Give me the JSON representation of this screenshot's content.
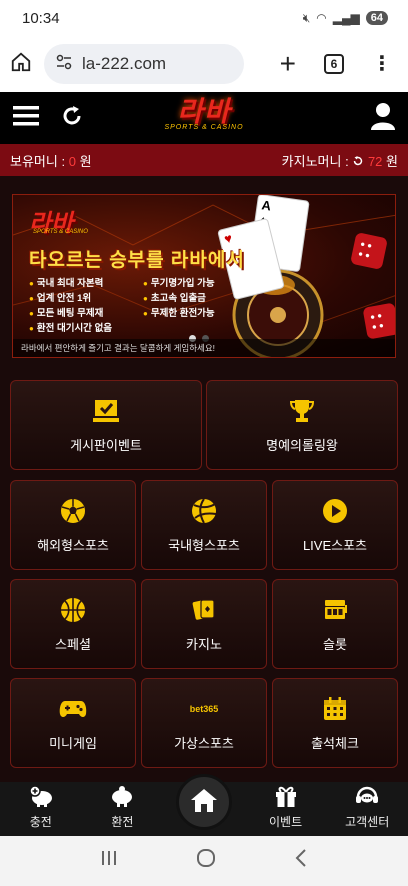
{
  "status": {
    "time": "10:34",
    "battery": "64"
  },
  "browser": {
    "url": "la-222.com",
    "tab_count": "6"
  },
  "site": {
    "logo": "라바",
    "logo_sub": "SPORTS & CASINO"
  },
  "balance": {
    "money_label": "보유머니 :",
    "money_value": "0",
    "money_unit": "원",
    "casino_label": "카지노머니 :",
    "casino_value": "72",
    "casino_unit": "원"
  },
  "banner": {
    "logo": "라바",
    "logo_sub": "SPORTS & CASINO",
    "title": "타오르는 승부를 라바에서",
    "features": [
      "국내 최대 자본력",
      "무기명가입 가능",
      "업계 안전 1위",
      "초고속 입출금",
      "모든 베팅 무제재",
      "무제한 환전가능",
      "환전 대기시간 없음"
    ],
    "caption": "라바에서 편안하게 즐기고 결과는 달콤하게 게임하세요!",
    "card_rank": "A"
  },
  "menu": {
    "board_event": "게시판이벤트",
    "hall_of_fame": "명예의롤링왕",
    "overseas_sports": "해외형스포츠",
    "domestic_sports": "국내형스포츠",
    "live_sports": "LIVE스포츠",
    "special": "스페셜",
    "casino": "카지노",
    "slot": "슬롯",
    "minigame": "미니게임",
    "virtual_sports": "가상스포츠",
    "virtual_badge": "bet365",
    "attendance": "출석체크"
  },
  "bottom_nav": {
    "deposit": "충전",
    "withdraw": "환전",
    "event": "이벤트",
    "support": "고객센터"
  },
  "colors": {
    "accent_red": "#7c0b12",
    "gold": "#ffc400",
    "money_red": "#ff3b3b"
  }
}
